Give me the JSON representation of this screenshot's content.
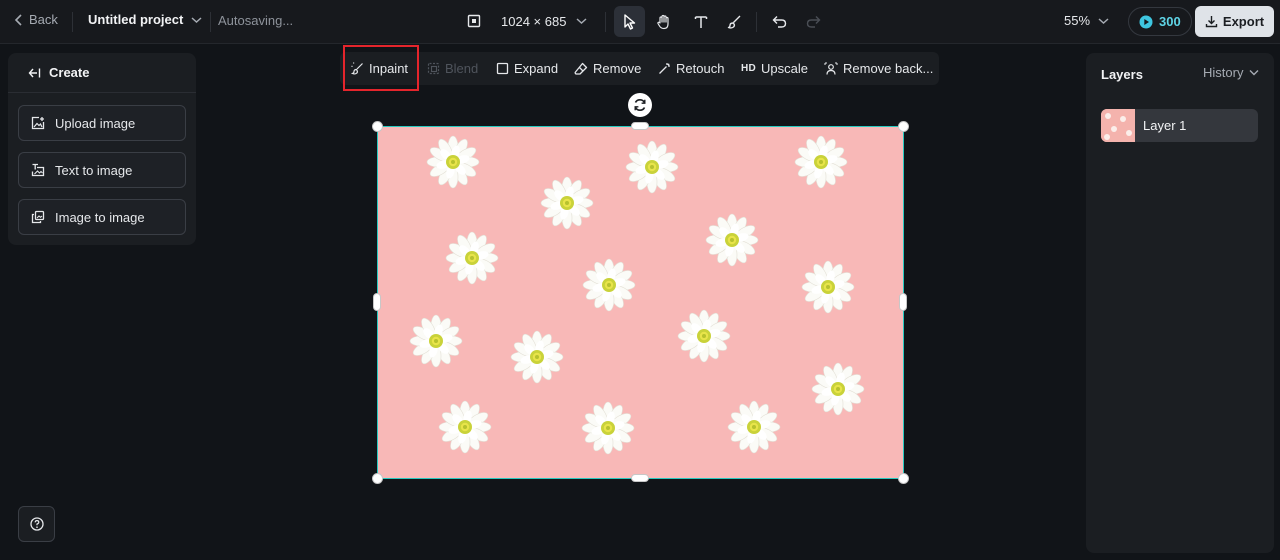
{
  "topbar": {
    "back_label": "Back",
    "project_title": "Untitled project",
    "autosave_status": "Autosaving...",
    "canvas_size": "1024 × 685",
    "zoom": "55%",
    "credits": "300",
    "export_label": "Export"
  },
  "tools": [
    "select-icon",
    "hand-icon",
    "text-icon",
    "brush-icon",
    "undo-icon",
    "redo-icon"
  ],
  "left_panel": {
    "header": "Create",
    "buttons": [
      {
        "label": "Upload image",
        "icon": "upload-image-icon"
      },
      {
        "label": "Text to image",
        "icon": "text-to-image-icon"
      },
      {
        "label": "Image to image",
        "icon": "image-to-image-icon"
      }
    ]
  },
  "edit_toolbar": {
    "items": [
      {
        "label": "Inpaint",
        "enabled": true
      },
      {
        "label": "Blend",
        "enabled": false
      },
      {
        "label": "Expand",
        "enabled": true
      },
      {
        "label": "Remove",
        "enabled": true
      },
      {
        "label": "Retouch",
        "enabled": true
      },
      {
        "label": "Upscale",
        "enabled": true,
        "badge": "HD"
      },
      {
        "label": "Remove back...",
        "enabled": true
      }
    ]
  },
  "right_panel": {
    "title": "Layers",
    "history_label": "History",
    "layers": [
      {
        "name": "Layer 1"
      }
    ]
  },
  "colors": {
    "background": "#111418",
    "panel": "#1b1e22",
    "accent": "#28c9c0",
    "credits": "#5fd4e6",
    "highlight": "#e5252c",
    "canvas_pink": "#f8b7b7"
  }
}
